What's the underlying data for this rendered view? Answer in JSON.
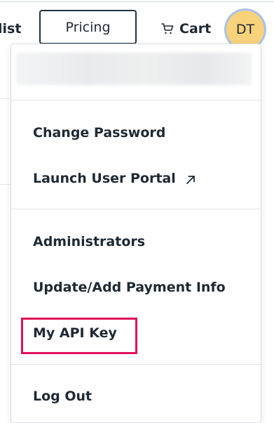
{
  "nav": {
    "partial_link": "list",
    "pricing_label": "Pricing",
    "cart_label": "Cart",
    "cart_icon": "cart-icon",
    "avatar_initials": "DT"
  },
  "menu": {
    "items": [
      {
        "label": "Change Password"
      },
      {
        "label": "Launch User Portal",
        "icon": "external-link-icon"
      },
      {
        "label": "Administrators"
      },
      {
        "label": "Update/Add Payment Info"
      },
      {
        "label": "My API Key",
        "highlighted": true
      },
      {
        "label": "Log Out"
      }
    ]
  },
  "colors": {
    "text": "#1f2933",
    "avatar_bg": "#f9d27c",
    "avatar_ring": "#a9c1ea",
    "highlight": "#e0105a"
  }
}
